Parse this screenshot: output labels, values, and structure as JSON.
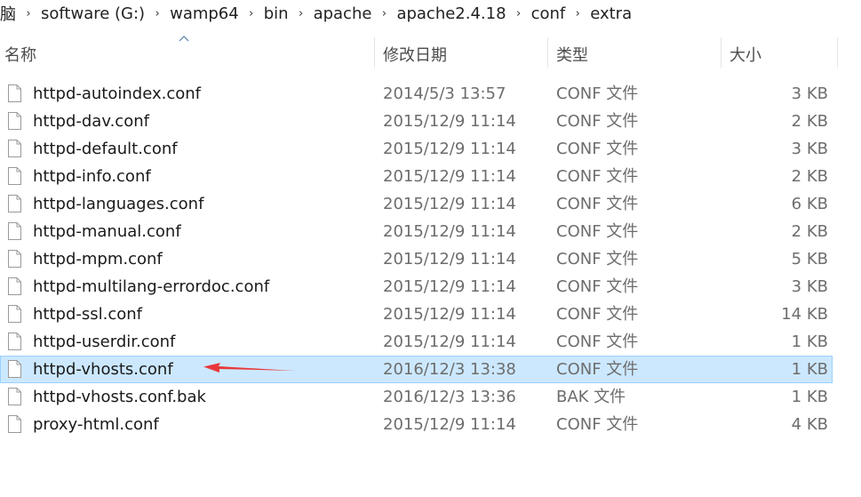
{
  "breadcrumb": {
    "items": [
      "脑",
      "software (G:)",
      "wamp64",
      "bin",
      "apache",
      "apache2.4.18",
      "conf",
      "extra"
    ],
    "separator": "›"
  },
  "columns": {
    "name": "名称",
    "date": "修改日期",
    "type": "类型",
    "size": "大小"
  },
  "files": [
    {
      "name": "httpd-autoindex.conf",
      "date": "2014/5/3 13:57",
      "type": "CONF 文件",
      "size": "3 KB"
    },
    {
      "name": "httpd-dav.conf",
      "date": "2015/12/9 11:14",
      "type": "CONF 文件",
      "size": "2 KB"
    },
    {
      "name": "httpd-default.conf",
      "date": "2015/12/9 11:14",
      "type": "CONF 文件",
      "size": "3 KB"
    },
    {
      "name": "httpd-info.conf",
      "date": "2015/12/9 11:14",
      "type": "CONF 文件",
      "size": "2 KB"
    },
    {
      "name": "httpd-languages.conf",
      "date": "2015/12/9 11:14",
      "type": "CONF 文件",
      "size": "6 KB"
    },
    {
      "name": "httpd-manual.conf",
      "date": "2015/12/9 11:14",
      "type": "CONF 文件",
      "size": "2 KB"
    },
    {
      "name": "httpd-mpm.conf",
      "date": "2015/12/9 11:14",
      "type": "CONF 文件",
      "size": "5 KB"
    },
    {
      "name": "httpd-multilang-errordoc.conf",
      "date": "2015/12/9 11:14",
      "type": "CONF 文件",
      "size": "3 KB"
    },
    {
      "name": "httpd-ssl.conf",
      "date": "2015/12/9 11:14",
      "type": "CONF 文件",
      "size": "14 KB"
    },
    {
      "name": "httpd-userdir.conf",
      "date": "2015/12/9 11:14",
      "type": "CONF 文件",
      "size": "1 KB"
    },
    {
      "name": "httpd-vhosts.conf",
      "date": "2016/12/3 13:38",
      "type": "CONF 文件",
      "size": "1 KB",
      "selected": true
    },
    {
      "name": "httpd-vhosts.conf.bak",
      "date": "2016/12/3 13:36",
      "type": "BAK 文件",
      "size": "1 KB"
    },
    {
      "name": "proxy-html.conf",
      "date": "2015/12/9 11:14",
      "type": "CONF 文件",
      "size": "4 KB"
    }
  ],
  "colors": {
    "selection_bg": "#cce8ff",
    "selection_border": "#99d1ff",
    "annotation": "#e8383b"
  },
  "icons": {
    "file": "file-icon",
    "sort": "sort-ascending-icon",
    "annotation": "red-arrow-icon"
  }
}
